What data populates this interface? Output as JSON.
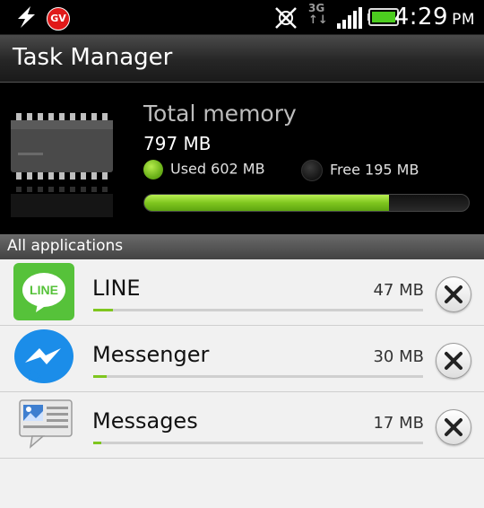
{
  "status_bar": {
    "time": "4:29",
    "ampm": "PM",
    "network": "3G",
    "gv_badge": "GV",
    "icons": [
      "flash-icon",
      "gv-icon",
      "sync-off-icon",
      "network-3g-icon",
      "signal-icon",
      "battery-icon"
    ]
  },
  "title_bar": {
    "title": "Task Manager"
  },
  "memory": {
    "title": "Total memory",
    "total": "797 MB",
    "used_label": "Used 602 MB",
    "free_label": "Free 195 MB",
    "used_fraction": 0.755,
    "used_color": "#7fc61f"
  },
  "section": {
    "label": "All applications"
  },
  "apps": [
    {
      "name": "LINE",
      "size": "47 MB",
      "usage_fraction": 0.06,
      "icon": "line-icon"
    },
    {
      "name": "Messenger",
      "size": "30 MB",
      "usage_fraction": 0.04,
      "icon": "messenger-icon"
    },
    {
      "name": "Messages",
      "size": "17 MB",
      "usage_fraction": 0.025,
      "icon": "messages-icon"
    }
  ]
}
